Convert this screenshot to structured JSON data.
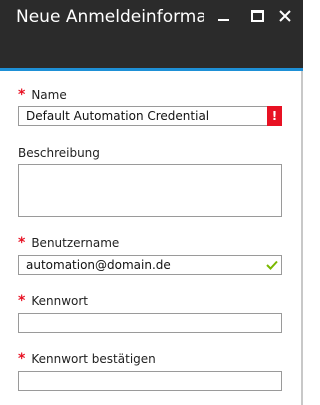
{
  "window": {
    "title": "Neue Anmeldeinforma...",
    "controls": [
      "minimize-icon",
      "maximize-icon",
      "close-icon"
    ],
    "accent_color": "#1e90d6",
    "header_color": "#2b2b2b"
  },
  "form": {
    "name": {
      "label": "Name",
      "required": true,
      "value": "Default Automation Credential",
      "status": "error",
      "error_glyph": "!"
    },
    "description": {
      "label": "Beschreibung",
      "required": false,
      "value": ""
    },
    "username": {
      "label": "Benutzername",
      "required": true,
      "value": "automation@domain.de",
      "status": "valid"
    },
    "password": {
      "label": "Kennwort",
      "required": true,
      "value": ""
    },
    "password_confirm": {
      "label": "Kennwort bestätigen",
      "required": true,
      "value": ""
    },
    "required_marker": "*",
    "required_color": "#e81123",
    "valid_color": "#7ab800"
  }
}
